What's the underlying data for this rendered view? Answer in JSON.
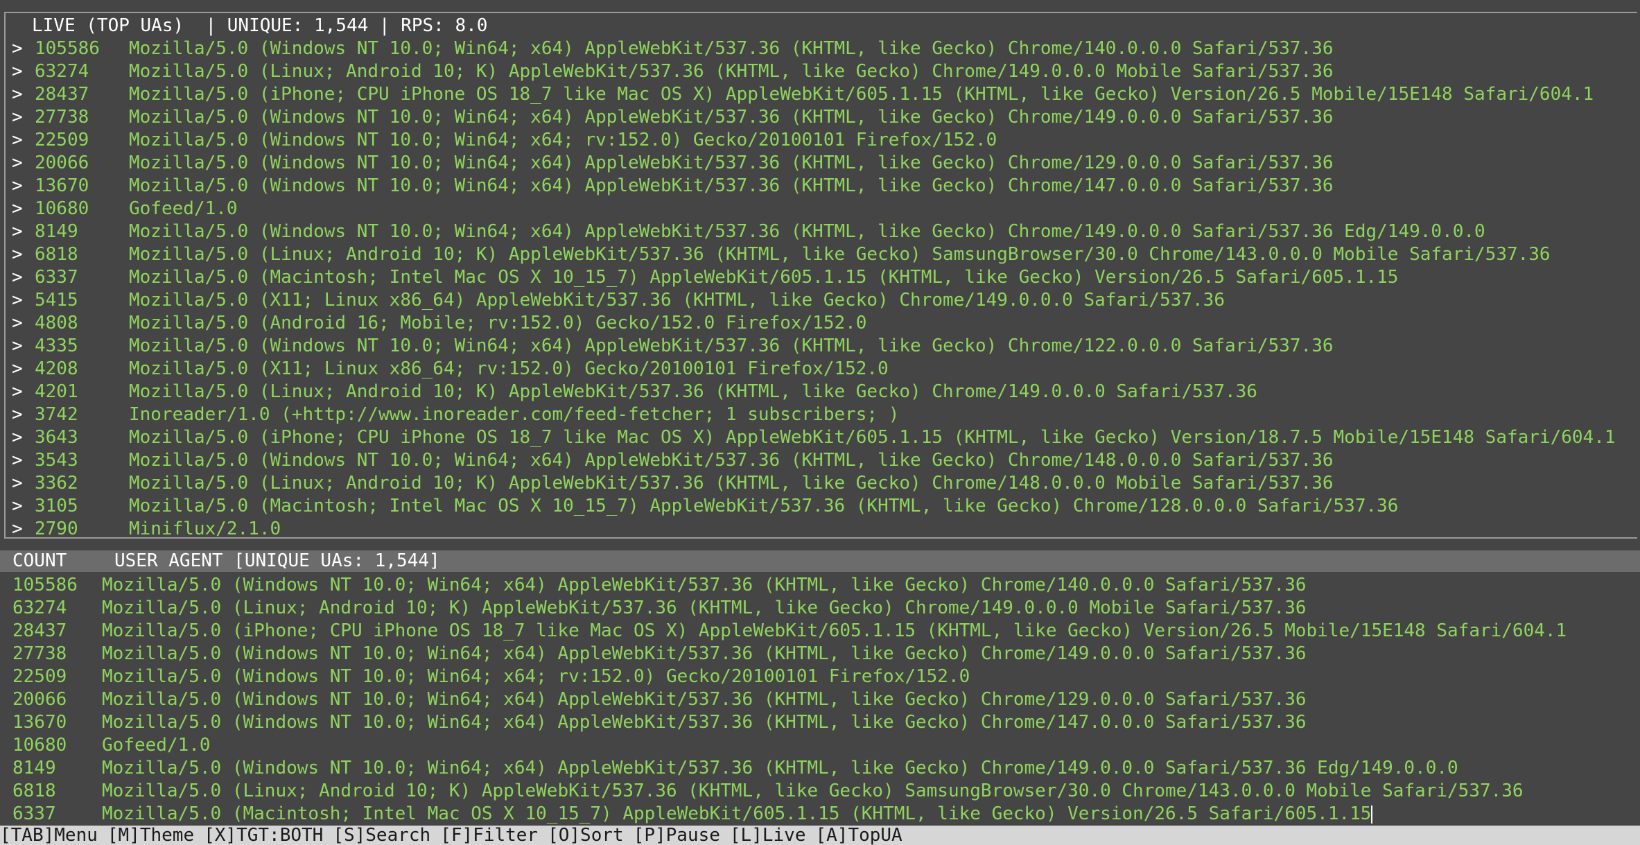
{
  "live_panel": {
    "title": "LIVE (TOP UAs)  | UNIQUE: 1,544 | RPS: 8.0",
    "prompt": ">",
    "rows": [
      {
        "count": "105586",
        "ua": "Mozilla/5.0 (Windows NT 10.0; Win64; x64) AppleWebKit/537.36 (KHTML, like Gecko) Chrome/140.0.0.0 Safari/537.36"
      },
      {
        "count": "63274",
        "ua": "Mozilla/5.0 (Linux; Android 10; K) AppleWebKit/537.36 (KHTML, like Gecko) Chrome/149.0.0.0 Mobile Safari/537.36"
      },
      {
        "count": "28437",
        "ua": "Mozilla/5.0 (iPhone; CPU iPhone OS 18_7 like Mac OS X) AppleWebKit/605.1.15 (KHTML, like Gecko) Version/26.5 Mobile/15E148 Safari/604.1"
      },
      {
        "count": "27738",
        "ua": "Mozilla/5.0 (Windows NT 10.0; Win64; x64) AppleWebKit/537.36 (KHTML, like Gecko) Chrome/149.0.0.0 Safari/537.36"
      },
      {
        "count": "22509",
        "ua": "Mozilla/5.0 (Windows NT 10.0; Win64; x64; rv:152.0) Gecko/20100101 Firefox/152.0"
      },
      {
        "count": "20066",
        "ua": "Mozilla/5.0 (Windows NT 10.0; Win64; x64) AppleWebKit/537.36 (KHTML, like Gecko) Chrome/129.0.0.0 Safari/537.36"
      },
      {
        "count": "13670",
        "ua": "Mozilla/5.0 (Windows NT 10.0; Win64; x64) AppleWebKit/537.36 (KHTML, like Gecko) Chrome/147.0.0.0 Safari/537.36"
      },
      {
        "count": "10680",
        "ua": "Gofeed/1.0"
      },
      {
        "count": "8149",
        "ua": "Mozilla/5.0 (Windows NT 10.0; Win64; x64) AppleWebKit/537.36 (KHTML, like Gecko) Chrome/149.0.0.0 Safari/537.36 Edg/149.0.0.0"
      },
      {
        "count": "6818",
        "ua": "Mozilla/5.0 (Linux; Android 10; K) AppleWebKit/537.36 (KHTML, like Gecko) SamsungBrowser/30.0 Chrome/143.0.0.0 Mobile Safari/537.36"
      },
      {
        "count": "6337",
        "ua": "Mozilla/5.0 (Macintosh; Intel Mac OS X 10_15_7) AppleWebKit/605.1.15 (KHTML, like Gecko) Version/26.5 Safari/605.1.15"
      },
      {
        "count": "5415",
        "ua": "Mozilla/5.0 (X11; Linux x86_64) AppleWebKit/537.36 (KHTML, like Gecko) Chrome/149.0.0.0 Safari/537.36"
      },
      {
        "count": "4808",
        "ua": "Mozilla/5.0 (Android 16; Mobile; rv:152.0) Gecko/152.0 Firefox/152.0"
      },
      {
        "count": "4335",
        "ua": "Mozilla/5.0 (Windows NT 10.0; Win64; x64) AppleWebKit/537.36 (KHTML, like Gecko) Chrome/122.0.0.0 Safari/537.36"
      },
      {
        "count": "4208",
        "ua": "Mozilla/5.0 (X11; Linux x86_64; rv:152.0) Gecko/20100101 Firefox/152.0"
      },
      {
        "count": "4201",
        "ua": "Mozilla/5.0 (Linux; Android 10; K) AppleWebKit/537.36 (KHTML, like Gecko) Chrome/149.0.0.0 Safari/537.36"
      },
      {
        "count": "3742",
        "ua": "Inoreader/1.0 (+http://www.inoreader.com/feed-fetcher; 1 subscribers; )"
      },
      {
        "count": "3643",
        "ua": "Mozilla/5.0 (iPhone; CPU iPhone OS 18_7 like Mac OS X) AppleWebKit/605.1.15 (KHTML, like Gecko) Version/18.7.5 Mobile/15E148 Safari/604.1"
      },
      {
        "count": "3543",
        "ua": "Mozilla/5.0 (Windows NT 10.0; Win64; x64) AppleWebKit/537.36 (KHTML, like Gecko) Chrome/148.0.0.0 Safari/537.36"
      },
      {
        "count": "3362",
        "ua": "Mozilla/5.0 (Linux; Android 10; K) AppleWebKit/537.36 (KHTML, like Gecko) Chrome/148.0.0.0 Mobile Safari/537.36"
      },
      {
        "count": "3105",
        "ua": "Mozilla/5.0 (Macintosh; Intel Mac OS X 10_15_7) AppleWebKit/537.36 (KHTML, like Gecko) Chrome/128.0.0.0 Safari/537.36"
      },
      {
        "count": "2790",
        "ua": "Miniflux/2.1.0"
      }
    ]
  },
  "table": {
    "header_count": "COUNT",
    "header_ua": "USER AGENT [UNIQUE UAs: 1,544]",
    "rows": [
      {
        "count": "105586",
        "ua": "Mozilla/5.0 (Windows NT 10.0; Win64; x64) AppleWebKit/537.36 (KHTML, like Gecko) Chrome/140.0.0.0 Safari/537.36"
      },
      {
        "count": "63274",
        "ua": "Mozilla/5.0 (Linux; Android 10; K) AppleWebKit/537.36 (KHTML, like Gecko) Chrome/149.0.0.0 Mobile Safari/537.36"
      },
      {
        "count": "28437",
        "ua": "Mozilla/5.0 (iPhone; CPU iPhone OS 18_7 like Mac OS X) AppleWebKit/605.1.15 (KHTML, like Gecko) Version/26.5 Mobile/15E148 Safari/604.1"
      },
      {
        "count": "27738",
        "ua": "Mozilla/5.0 (Windows NT 10.0; Win64; x64) AppleWebKit/537.36 (KHTML, like Gecko) Chrome/149.0.0.0 Safari/537.36"
      },
      {
        "count": "22509",
        "ua": "Mozilla/5.0 (Windows NT 10.0; Win64; x64; rv:152.0) Gecko/20100101 Firefox/152.0"
      },
      {
        "count": "20066",
        "ua": "Mozilla/5.0 (Windows NT 10.0; Win64; x64) AppleWebKit/537.36 (KHTML, like Gecko) Chrome/129.0.0.0 Safari/537.36"
      },
      {
        "count": "13670",
        "ua": "Mozilla/5.0 (Windows NT 10.0; Win64; x64) AppleWebKit/537.36 (KHTML, like Gecko) Chrome/147.0.0.0 Safari/537.36"
      },
      {
        "count": "10680",
        "ua": "Gofeed/1.0"
      },
      {
        "count": "8149",
        "ua": "Mozilla/5.0 (Windows NT 10.0; Win64; x64) AppleWebKit/537.36 (KHTML, like Gecko) Chrome/149.0.0.0 Safari/537.36 Edg/149.0.0.0"
      },
      {
        "count": "6818",
        "ua": "Mozilla/5.0 (Linux; Android 10; K) AppleWebKit/537.36 (KHTML, like Gecko) SamsungBrowser/30.0 Chrome/143.0.0.0 Mobile Safari/537.36"
      },
      {
        "count": "6337",
        "ua": "Mozilla/5.0 (Macintosh; Intel Mac OS X 10_15_7) AppleWebKit/605.1.15 (KHTML, like Gecko) Version/26.5 Safari/605.1.15"
      }
    ]
  },
  "footer": {
    "menu": "[TAB]Menu",
    "theme": "[M]Theme",
    "target": "[X]TGT:BOTH",
    "search": "[S]Search",
    "filter": "[F]Filter",
    "sort": "[O]Sort",
    "pause": "[P]Pause",
    "live": "[L]Live",
    "top_ua": "[A]TopUA"
  },
  "colors": {
    "background": "#454545",
    "accent_green": "#8fd45c",
    "header_bar": "#6c6c6c",
    "footer_bar": "#d6d6d6"
  }
}
